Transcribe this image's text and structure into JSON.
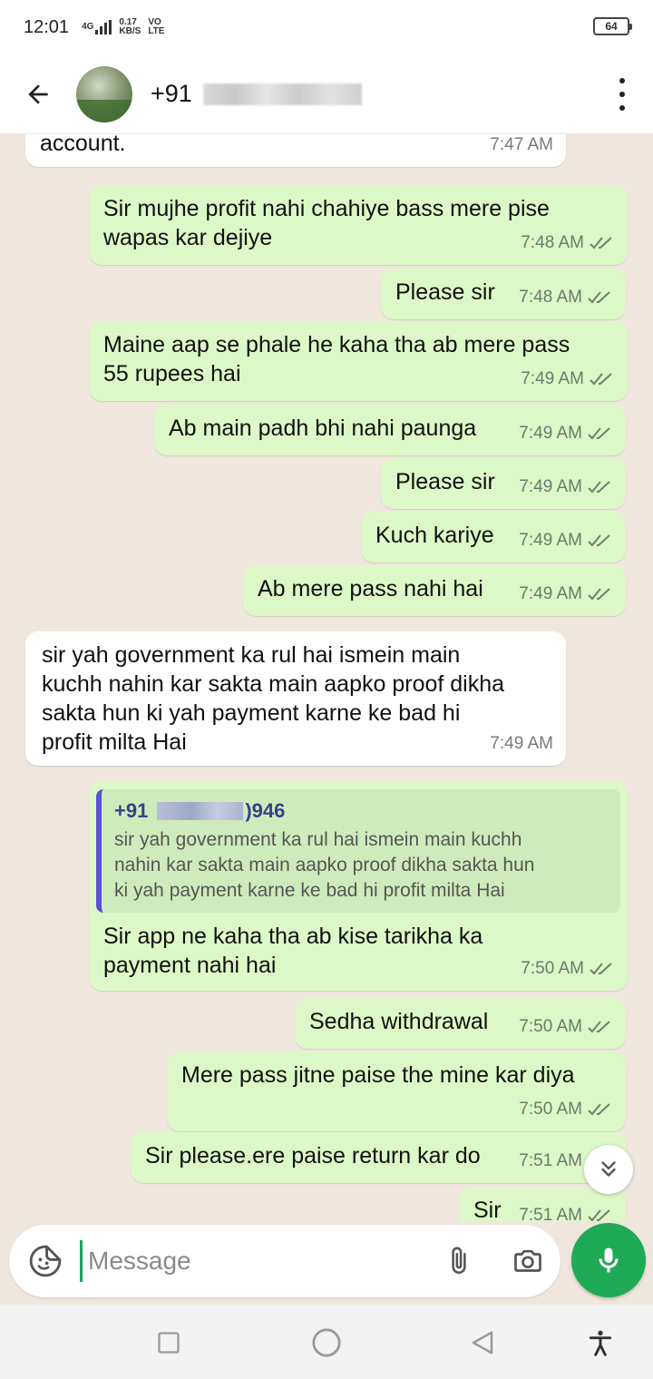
{
  "status_bar": {
    "time": "12:01",
    "network": "4G",
    "speed_value": "0.17",
    "speed_unit": "KB/S",
    "volte_top": "VO",
    "volte_bottom": "LTE",
    "battery": "64"
  },
  "header": {
    "contact_prefix": "+91",
    "contact_redacted": true,
    "back_icon": "arrow-left-icon",
    "menu_icon": "more-vertical-icon"
  },
  "messages": [
    {
      "dir": "in",
      "text": "account.",
      "time": "7:47 AM"
    },
    {
      "dir": "out",
      "text": "Sir mujhe profit nahi chahiye bass mere pise\nwapas kar dejiye",
      "time": "7:48 AM"
    },
    {
      "dir": "out",
      "text": "Please sir",
      "time": "7:48 AM"
    },
    {
      "dir": "out",
      "text": "Maine aap se phale he kaha tha ab mere pass\n55 rupees hai",
      "time": "7:49 AM"
    },
    {
      "dir": "out",
      "text": "Ab main padh bhi nahi paunga",
      "time": "7:49 AM"
    },
    {
      "dir": "out",
      "text": "Please sir",
      "time": "7:49 AM"
    },
    {
      "dir": "out",
      "text": "Kuch kariye",
      "time": "7:49 AM"
    },
    {
      "dir": "out",
      "text": "Ab mere pass nahi hai",
      "time": "7:49 AM"
    },
    {
      "dir": "in",
      "text": "sir yah government ka rul hai ismein main\nkuchh nahin kar sakta main aapko proof dikha\nsakta hun ki yah payment karne ke bad hi\nprofit milta Hai",
      "time": "7:49 AM"
    },
    {
      "dir": "out",
      "quote_name_prefix": "+91",
      "quote_name_suffix": ")946",
      "quote_text": "sir yah government ka rul hai ismein main kuchh\nnahin kar sakta main aapko proof dikha sakta hun\nki yah payment karne ke bad hi profit milta Hai",
      "text": "Sir app ne kaha tha ab kise tarikha ka\npayment nahi hai",
      "time": "7:50 AM"
    },
    {
      "dir": "out",
      "text": "Sedha withdrawal",
      "time": "7:50 AM"
    },
    {
      "dir": "out",
      "text": "Mere pass jitne paise the mine kar diya",
      "time": "7:50 AM"
    },
    {
      "dir": "out",
      "text": "Sir please.ere paise return kar do",
      "time": "7:51 AM"
    },
    {
      "dir": "out",
      "text": "Sir",
      "time": "7:51 AM"
    }
  ],
  "input": {
    "placeholder": "Message",
    "emoji_icon": "sticker-icon",
    "attach_icon": "paperclip-icon",
    "camera_icon": "camera-icon",
    "mic_icon": "microphone-icon"
  },
  "colors": {
    "outgoing": "#dcf8c6",
    "incoming": "#ffffff",
    "accent": "#1faa55",
    "quote_bar": "#5b4fd6"
  }
}
